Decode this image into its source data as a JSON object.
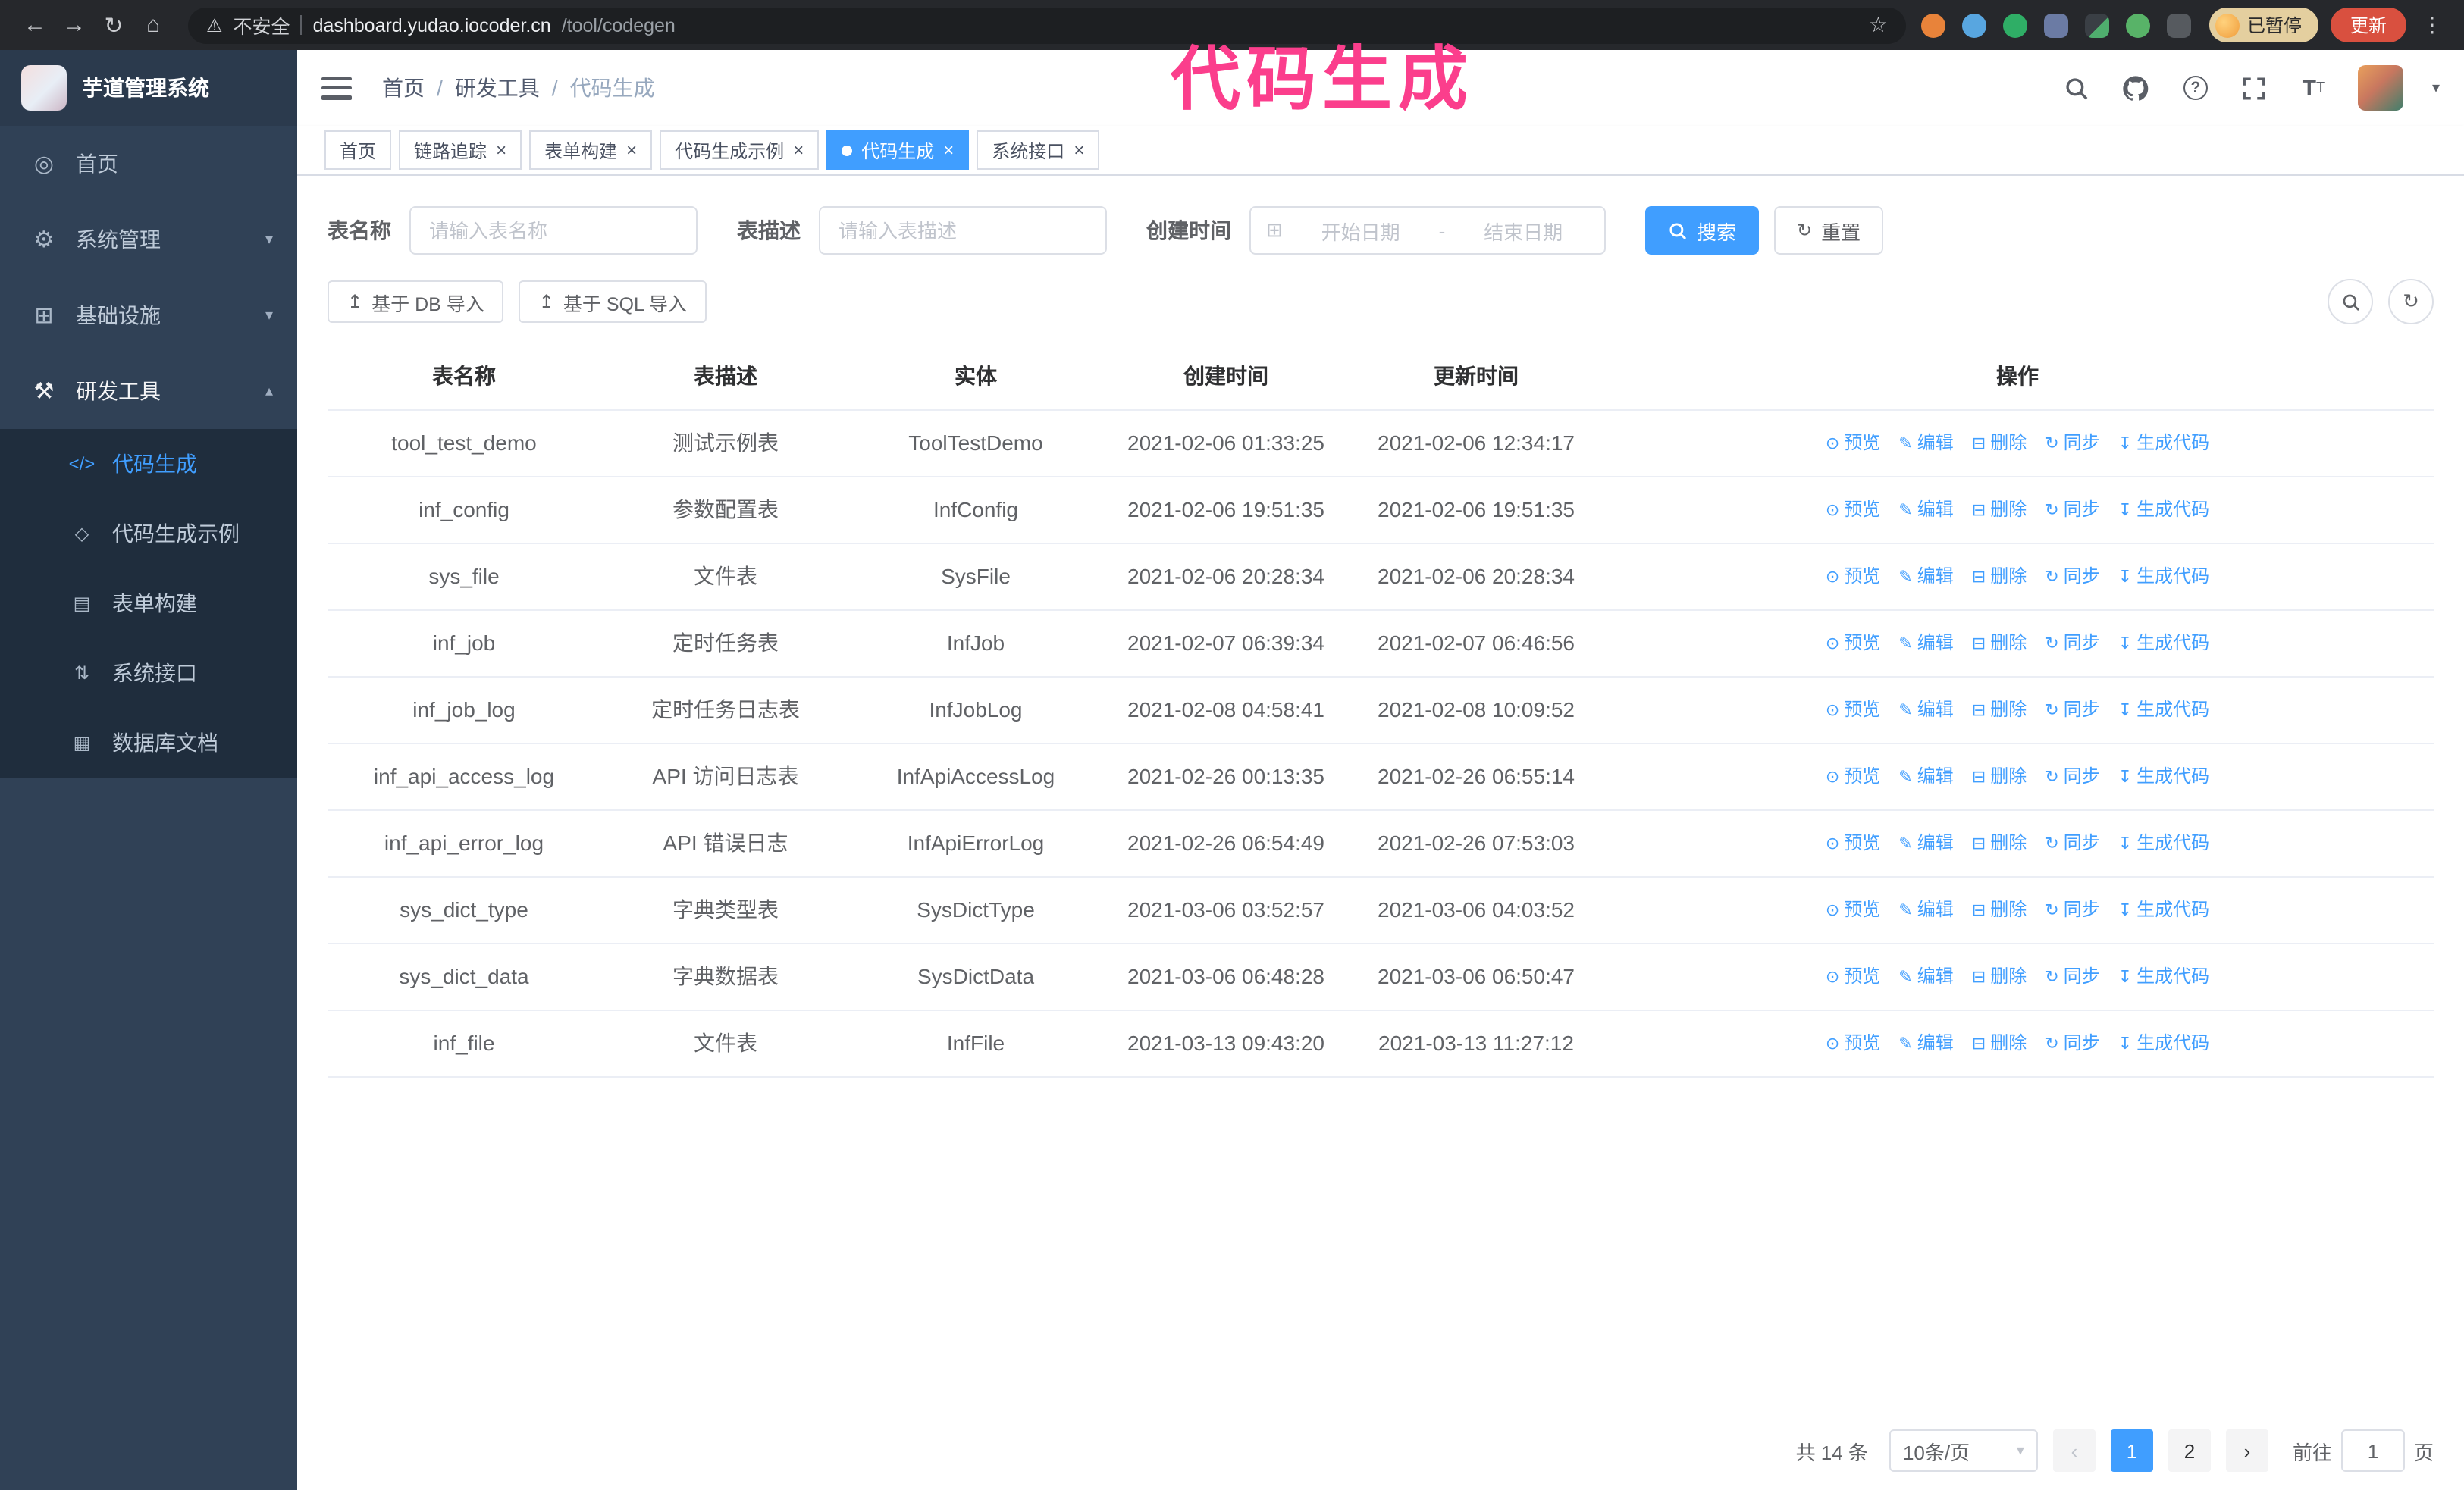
{
  "annotation": {
    "text": "代码生成"
  },
  "browser": {
    "back_icon": "←",
    "forward_icon": "→",
    "reload_icon": "↻",
    "home_icon": "⌂",
    "warning_icon": "⚠",
    "security_label": "不安全",
    "url_host": "dashboard.yudao.iocoder.cn",
    "url_path": "/tool/codegen",
    "star_icon": "☆",
    "paused_label": "已暂停",
    "update_label": "更新",
    "kebab_icon": "⋮"
  },
  "icons": {
    "chevron_down": "▾",
    "chevron_up": "▴",
    "menu_dashboard": "◎",
    "menu_system": "⚙",
    "menu_infra": "⊞",
    "menu_dev": "⚒",
    "sub_codegen": "</>",
    "sub_example": "◇",
    "sub_form": "▤",
    "sub_api": "⇅",
    "sub_db": "▦",
    "calendar": "⊞",
    "refresh": "↻",
    "upload": "↥",
    "close": "×",
    "question": "?"
  },
  "sidebar": {
    "logo_title": "芋道管理系统",
    "items": [
      {
        "label": "首页"
      },
      {
        "label": "系统管理"
      },
      {
        "label": "基础设施"
      },
      {
        "label": "研发工具"
      }
    ],
    "submenu": [
      {
        "label": "代码生成"
      },
      {
        "label": "代码生成示例"
      },
      {
        "label": "表单构建"
      },
      {
        "label": "系统接口"
      },
      {
        "label": "数据库文档"
      }
    ]
  },
  "header": {
    "breadcrumb": [
      "首页",
      "研发工具",
      "代码生成"
    ],
    "separator": "/",
    "font_icon_big": "T",
    "font_icon_small": "T"
  },
  "tabs": [
    {
      "label": "首页",
      "closable": false,
      "active": false
    },
    {
      "label": "链路追踪",
      "closable": true,
      "active": false
    },
    {
      "label": "表单构建",
      "closable": true,
      "active": false
    },
    {
      "label": "代码生成示例",
      "closable": true,
      "active": false
    },
    {
      "label": "代码生成",
      "closable": true,
      "active": true
    },
    {
      "label": "系统接口",
      "closable": true,
      "active": false
    }
  ],
  "filters": {
    "table_name_label": "表名称",
    "table_name_placeholder": "请输入表名称",
    "table_desc_label": "表描述",
    "table_desc_placeholder": "请输入表描述",
    "create_time_label": "创建时间",
    "date_start_placeholder": "开始日期",
    "date_separator": "-",
    "date_end_placeholder": "结束日期",
    "search_button": "搜索",
    "reset_button": "重置"
  },
  "toolbar": {
    "import_db_button": "基于 DB 导入",
    "import_sql_button": "基于 SQL 导入"
  },
  "table": {
    "columns": [
      "表名称",
      "表描述",
      "实体",
      "创建时间",
      "更新时间",
      "操作"
    ],
    "actions": [
      {
        "id": "preview",
        "label": "预览",
        "icon": "⊙"
      },
      {
        "id": "edit",
        "label": "编辑",
        "icon": "✎"
      },
      {
        "id": "delete",
        "label": "删除",
        "icon": "⊟"
      },
      {
        "id": "sync",
        "label": "同步",
        "icon": "↻"
      },
      {
        "id": "generate-code",
        "label": "生成代码",
        "icon": "↧"
      }
    ],
    "rows": [
      {
        "name": "tool_test_demo",
        "description": "测试示例表",
        "entity": "ToolTestDemo",
        "created": "2021-02-06 01:33:25",
        "updated": "2021-02-06 12:34:17"
      },
      {
        "name": "inf_config",
        "description": "参数配置表",
        "entity": "InfConfig",
        "created": "2021-02-06 19:51:35",
        "updated": "2021-02-06 19:51:35"
      },
      {
        "name": "sys_file",
        "description": "文件表",
        "entity": "SysFile",
        "created": "2021-02-06 20:28:34",
        "updated": "2021-02-06 20:28:34"
      },
      {
        "name": "inf_job",
        "description": "定时任务表",
        "entity": "InfJob",
        "created": "2021-02-07 06:39:34",
        "updated": "2021-02-07 06:46:56"
      },
      {
        "name": "inf_job_log",
        "description": "定时任务日志表",
        "entity": "InfJobLog",
        "created": "2021-02-08 04:58:41",
        "updated": "2021-02-08 10:09:52"
      },
      {
        "name": "inf_api_access_log",
        "description": "API 访问日志表",
        "entity": "InfApiAccessLog",
        "created": "2021-02-26 00:13:35",
        "updated": "2021-02-26 06:55:14"
      },
      {
        "name": "inf_api_error_log",
        "description": "API 错误日志",
        "entity": "InfApiErrorLog",
        "created": "2021-02-26 06:54:49",
        "updated": "2021-02-26 07:53:03"
      },
      {
        "name": "sys_dict_type",
        "description": "字典类型表",
        "entity": "SysDictType",
        "created": "2021-03-06 03:52:57",
        "updated": "2021-03-06 04:03:52"
      },
      {
        "name": "sys_dict_data",
        "description": "字典数据表",
        "entity": "SysDictData",
        "created": "2021-03-06 06:48:28",
        "updated": "2021-03-06 06:50:47"
      },
      {
        "name": "inf_file",
        "description": "文件表",
        "entity": "InfFile",
        "created": "2021-03-13 09:43:20",
        "updated": "2021-03-13 11:27:12"
      }
    ]
  },
  "pagination": {
    "total": "共 14 条",
    "page_size": "10条/页",
    "prev_icon": "‹",
    "next_icon": "›",
    "pages": [
      "1",
      "2"
    ],
    "active_page": "1",
    "goto_label": "前往",
    "goto_value": "1",
    "goto_suffix": "页"
  }
}
